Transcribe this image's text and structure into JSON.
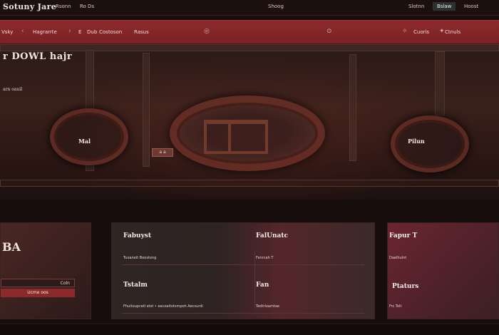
{
  "app": {
    "title": "Sotuny Jare"
  },
  "topbar": {
    "tabs": [
      {
        "label": "Rsonn"
      },
      {
        "label": "Ro Ds"
      },
      {
        "label": "Shoog"
      },
      {
        "label": "Slotnn"
      },
      {
        "label": "Bslaw"
      },
      {
        "label": "Hoost"
      }
    ],
    "active_tab": "Bslaw"
  },
  "navbar": {
    "items": [
      {
        "label": "Vsky"
      },
      {
        "label": "Hagrarrte"
      },
      {
        "label": "E"
      },
      {
        "label": "Dub"
      },
      {
        "label": "Costoson"
      },
      {
        "label": "Rasus"
      },
      {
        "label": "Cuoris"
      },
      {
        "label": "Ctnuls"
      }
    ]
  },
  "hero": {
    "heading": "r DOWL hajr",
    "subtext": "arn oauil",
    "labels": [
      "Mal",
      "Pilun"
    ],
    "chip": "a a"
  },
  "panels": {
    "left": {
      "title": "BA",
      "field_value": "Coln",
      "button": "Ucme oos"
    },
    "middle": {
      "sections": [
        {
          "title": "Fabuyst",
          "line": "Tuoaneit Beostong"
        },
        {
          "title": "FalUnatc",
          "line": "Fenrcah T"
        },
        {
          "title": "Tstalm",
          "line": "Fhuitoupcetl etst • eacoaitotsmpoh Aecsurdi"
        },
        {
          "title": "Fan",
          "line": "Tedtrioamtae"
        }
      ]
    },
    "right": {
      "title": "Fapur T",
      "line1": "Daelhulnt",
      "title2": "Ptaturs",
      "line2": "Frc.Tolt"
    }
  },
  "colors": {
    "accent": "#8c2a2c",
    "background": "#160d0c",
    "text": "#e8d8d2"
  }
}
